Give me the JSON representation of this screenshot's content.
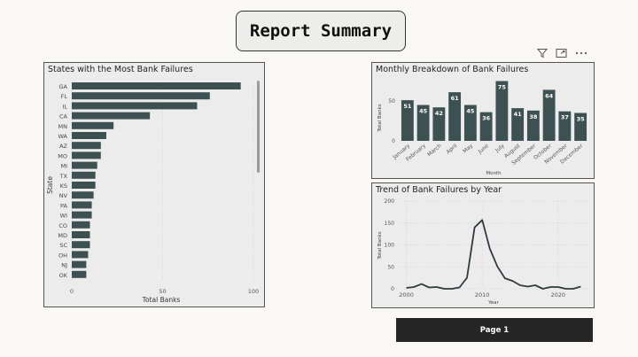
{
  "report_title": "Report Summary",
  "page_button": "Page 1",
  "toolbar": {
    "filter_icon": "filter-icon",
    "focus_icon": "focus-mode-icon",
    "more_icon": "more-options-icon"
  },
  "colors": {
    "bar": "#3e5152",
    "line": "#2f3b3c",
    "panel": "#ececec",
    "grid": "#cfcfcf"
  },
  "panels": {
    "states": {
      "title": "States with the Most Bank Failures"
    },
    "monthly": {
      "title": "Monthly Breakdown of Bank Failures"
    },
    "trend": {
      "title": "Trend of Bank Failures by Year"
    }
  },
  "chart_data": [
    {
      "type": "bar",
      "orientation": "horizontal",
      "title": "States with the Most Bank Failures",
      "xlabel": "Total Banks",
      "ylabel": "State",
      "categories": [
        "GA",
        "FL",
        "IL",
        "CA",
        "MN",
        "WA",
        "AZ",
        "MO",
        "MI",
        "TX",
        "KS",
        "NV",
        "PA",
        "WI",
        "CO",
        "MD",
        "SC",
        "OH",
        "NJ",
        "OK"
      ],
      "values": [
        93,
        76,
        69,
        43,
        23,
        19,
        16,
        16,
        14,
        13,
        13,
        12,
        11,
        11,
        10,
        10,
        10,
        9,
        8,
        8
      ],
      "xlim": [
        0,
        100
      ],
      "xticks": [
        "0",
        "50",
        "100"
      ],
      "grid": true
    },
    {
      "type": "bar",
      "title": "Monthly Breakdown of Bank Failures",
      "xlabel": "Month",
      "ylabel": "Total Banks",
      "categories": [
        "January",
        "February",
        "March",
        "April",
        "May",
        "June",
        "July",
        "August",
        "September",
        "October",
        "November",
        "December"
      ],
      "values": [
        51,
        45,
        42,
        61,
        45,
        36,
        75,
        41,
        38,
        64,
        37,
        35
      ],
      "ylim": [
        0,
        80
      ],
      "yticks": [
        "0",
        "50"
      ],
      "data_labels": true
    },
    {
      "type": "line",
      "title": "Trend of Bank Failures by Year",
      "xlabel": "Year",
      "ylabel": "Total Banks",
      "x": [
        2000,
        2001,
        2002,
        2003,
        2004,
        2005,
        2006,
        2007,
        2008,
        2009,
        2010,
        2011,
        2012,
        2013,
        2014,
        2015,
        2016,
        2017,
        2018,
        2019,
        2020,
        2021,
        2022,
        2023
      ],
      "y": [
        2,
        4,
        11,
        3,
        4,
        0,
        0,
        3,
        25,
        140,
        157,
        92,
        51,
        24,
        18,
        8,
        5,
        8,
        0,
        4,
        4,
        0,
        0,
        5
      ],
      "xlim": [
        1999,
        2024
      ],
      "ylim": [
        0,
        200
      ],
      "xticks": [
        "2000",
        "2010",
        "2020"
      ],
      "yticks": [
        "0",
        "50",
        "100",
        "150",
        "200"
      ],
      "grid": true
    }
  ]
}
